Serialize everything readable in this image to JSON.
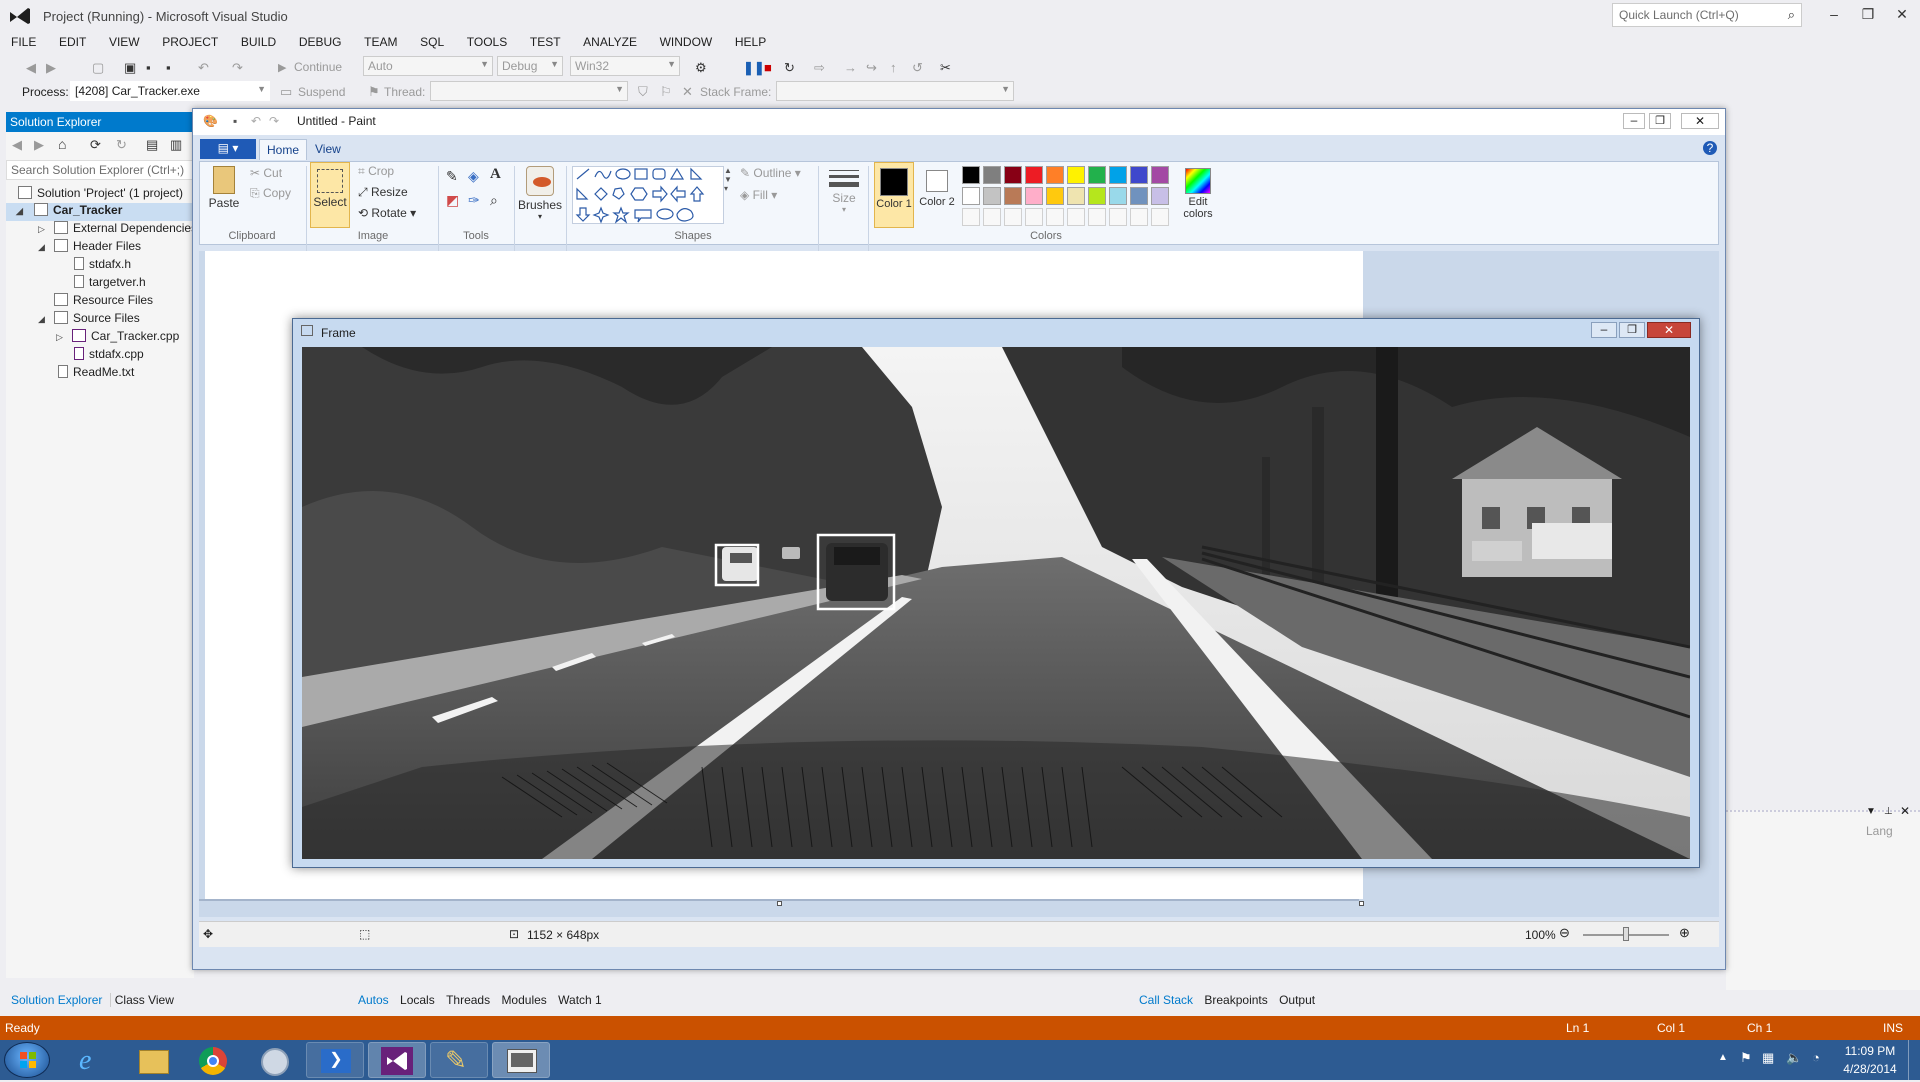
{
  "vs": {
    "title": "Project (Running) - Microsoft Visual Studio",
    "quick_launch": "Quick Launch (Ctrl+Q)",
    "menu": [
      "FILE",
      "EDIT",
      "VIEW",
      "PROJECT",
      "BUILD",
      "DEBUG",
      "TEAM",
      "SQL",
      "TOOLS",
      "TEST",
      "ANALYZE",
      "WINDOW",
      "HELP"
    ],
    "toolbar": {
      "continue": "Continue",
      "config_auto": "Auto",
      "config_debug": "Debug",
      "platform": "Win32",
      "process_label": "Process:",
      "process_value": "[4208] Car_Tracker.exe",
      "suspend": "Suspend",
      "thread_label": "Thread:",
      "stack_frame_label": "Stack Frame:"
    },
    "solution_explorer": {
      "header": "Solution Explorer",
      "search": "Search Solution Explorer (Ctrl+;)",
      "items": [
        {
          "label": "Solution 'Project' (1 project)"
        },
        {
          "label": "Car_Tracker"
        },
        {
          "label": "External Dependencies"
        },
        {
          "label": "Header Files"
        },
        {
          "label": "stdafx.h"
        },
        {
          "label": "targetver.h"
        },
        {
          "label": "Resource Files"
        },
        {
          "label": "Source Files"
        },
        {
          "label": "Car_Tracker.cpp"
        },
        {
          "label": "stdafx.cpp"
        },
        {
          "label": "ReadMe.txt"
        }
      ],
      "tabs": [
        "Solution Explorer",
        "Class View"
      ]
    },
    "bottom_tabs_left": [
      "Autos",
      "Locals",
      "Threads",
      "Modules",
      "Watch 1"
    ],
    "bottom_tabs_right": [
      "Call Stack",
      "Breakpoints",
      "Output"
    ],
    "right_panel_stub": "Lang",
    "status": {
      "text": "Ready",
      "ln": "Ln 1",
      "col": "Col 1",
      "ch": "Ch 1",
      "ins": "INS"
    }
  },
  "paint": {
    "title": "Untitled - Paint",
    "tabs": [
      "Home",
      "View"
    ],
    "clipboard": {
      "paste": "Paste",
      "cut": "Cut",
      "copy": "Copy",
      "group": "Clipboard"
    },
    "image": {
      "select": "Select",
      "crop": "Crop",
      "resize": "Resize",
      "rotate": "Rotate",
      "group": "Image"
    },
    "tools": {
      "group": "Tools"
    },
    "brushes": "Brushes",
    "shapes": {
      "outline": "Outline",
      "fill": "Fill",
      "group": "Shapes"
    },
    "size": "Size",
    "color1": "Color 1",
    "color2": "Color 2",
    "colors_group": "Colors",
    "edit_colors": "Edit colors",
    "palette": [
      "#000000",
      "#7f7f7f",
      "#880015",
      "#ed1c24",
      "#ff7f27",
      "#fff200",
      "#22b14c",
      "#00a2e8",
      "#3f48cc",
      "#a349a4",
      "#ffffff",
      "#c3c3c3",
      "#b97a57",
      "#ffaec9",
      "#ffc90e",
      "#efe4b0",
      "#b5e61d",
      "#99d9ea",
      "#7092be",
      "#c8bfe7"
    ],
    "status": {
      "dimensions": "1152 × 648px",
      "zoom": "100%"
    }
  },
  "frame_window": {
    "title": "Frame"
  },
  "taskbar": {
    "time": "11:09 PM",
    "date": "4/28/2014"
  }
}
